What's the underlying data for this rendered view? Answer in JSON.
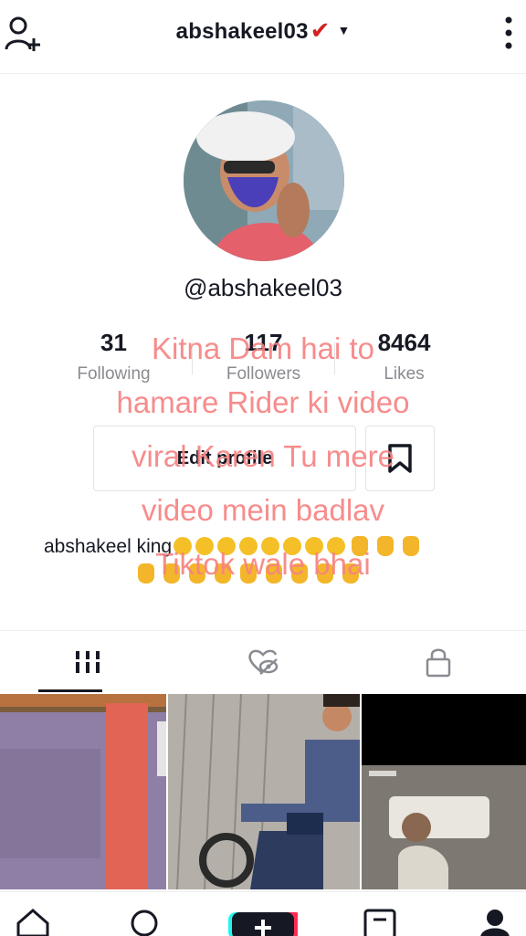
{
  "header": {
    "username": "abshakeel03",
    "verified_mark": "✔",
    "dropdown_caret": "▼",
    "icons": {
      "add_user": "add-user-icon",
      "menu": "more-vertical-icon"
    }
  },
  "profile": {
    "handle": "@abshakeel03",
    "stats": [
      {
        "value": "31",
        "label": "Following"
      },
      {
        "value": "117",
        "label": "Followers"
      },
      {
        "value": "8464",
        "label": "Likes"
      }
    ],
    "edit_profile_label": "Edit profile",
    "bio": "abshakeel king"
  },
  "overlay_text": {
    "lines": [
      "Kitna Dam hai to",
      "hamare Rider ki video",
      "viral Karen Tu mere",
      "video mein badlav",
      "Tiktok wale bhai"
    ],
    "color": "#f68282"
  },
  "tabs": {
    "items": [
      {
        "name": "videos",
        "icon": "grid-icon",
        "active": true
      },
      {
        "name": "liked",
        "icon": "liked-hidden-icon",
        "active": false
      },
      {
        "name": "private",
        "icon": "lock-icon",
        "active": false
      }
    ]
  },
  "bottom_nav": {
    "items": [
      "home-icon",
      "search-icon",
      "create-icon",
      "inbox-icon",
      "profile-icon"
    ]
  }
}
